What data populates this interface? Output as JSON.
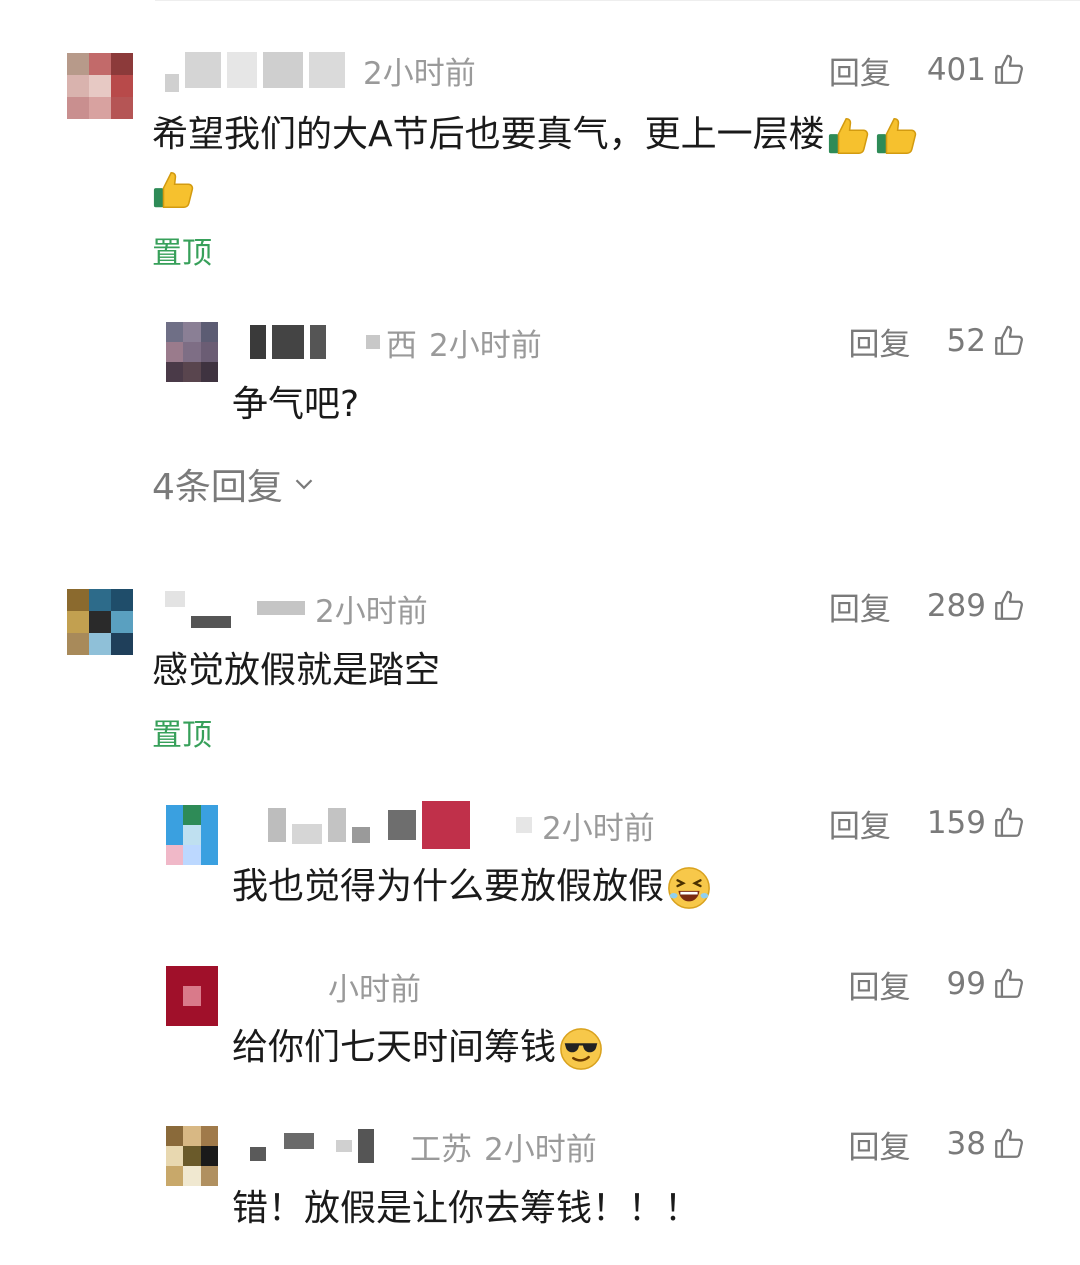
{
  "comments": [
    {
      "location_suffix": "",
      "time": "2小时前",
      "reply_label": "回复",
      "likes": "401",
      "text": "希望我们的大A节后也要真气，更上一层楼",
      "pinned_label": "置顶",
      "emojis": [
        "thumbs-up",
        "thumbs-up",
        "thumbs-up"
      ],
      "replies": [
        {
          "location_suffix": "西",
          "time": "2小时前",
          "reply_label": "回复",
          "likes": "52",
          "text": "争气吧?"
        }
      ],
      "more_replies_label": "4条回复"
    },
    {
      "location_suffix": "",
      "time": "2小时前",
      "reply_label": "回复",
      "likes": "289",
      "text": "感觉放假就是踏空",
      "pinned_label": "置顶",
      "replies": [
        {
          "location_suffix": "",
          "time": "2小时前",
          "reply_label": "回复",
          "likes": "159",
          "text": "我也觉得为什么要放假放假",
          "emoji": "laughing-face"
        },
        {
          "location_suffix": "",
          "time": "小时前",
          "reply_label": "回复",
          "likes": "99",
          "text": "给你们七天时间筹钱",
          "emoji": "sunglasses-face"
        },
        {
          "location_suffix": "工苏",
          "time": "2小时前",
          "reply_label": "回复",
          "likes": "38",
          "text": "错！放假是让你去筹钱！！！"
        }
      ]
    }
  ],
  "colors": {
    "pinned": "#37a05a",
    "meta": "#9a9a9a",
    "actions": "#7a7a7a",
    "text": "#1a1a1a"
  }
}
